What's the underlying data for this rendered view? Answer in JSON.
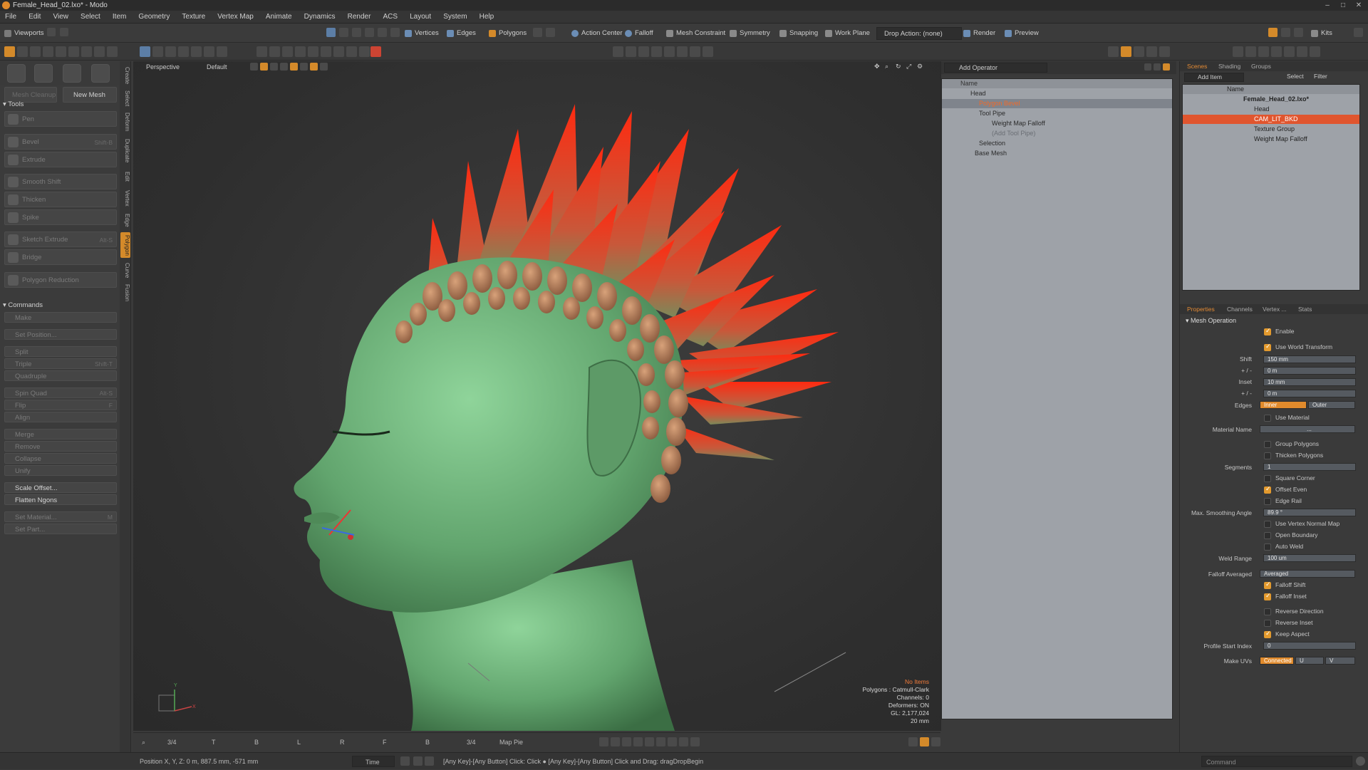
{
  "window": {
    "title": "Female_Head_02.lxo* - Modo"
  },
  "menu": [
    "File",
    "Edit",
    "View",
    "Select",
    "Item",
    "Geometry",
    "Texture",
    "Vertex Map",
    "Animate",
    "Dynamics",
    "Render",
    "ACS",
    "Layout",
    "System",
    "Help"
  ],
  "toolbar1": {
    "viewports": "Viewports",
    "vertices": "Vertices",
    "edges": "Edges",
    "polygons": "Polygons",
    "action_center": "Action Center",
    "falloff": "Falloff",
    "mesh_constraint": "Mesh Constraint",
    "symmetry": "Symmetry",
    "snapping": "Snapping",
    "work_plane": "Work Plane",
    "drop_action": "Drop Action: (none)",
    "render": "Render",
    "preview": "Preview",
    "kits": "Kits"
  },
  "left": {
    "mesh_cleanup": "Mesh Cleanup",
    "new_mesh": "New Mesh",
    "tools_header": "Tools",
    "tools": [
      {
        "label": "Pen",
        "shortcut": ""
      },
      {
        "label": "Bevel",
        "shortcut": "Shift-B"
      },
      {
        "label": "Extrude",
        "shortcut": ""
      },
      {
        "label": "Smooth Shift",
        "shortcut": ""
      },
      {
        "label": "Thicken",
        "shortcut": ""
      },
      {
        "label": "Spike",
        "shortcut": ""
      },
      {
        "label": "Sketch Extrude",
        "shortcut": "Alt-S"
      },
      {
        "label": "Bridge",
        "shortcut": ""
      },
      {
        "label": "Polygon Reduction",
        "shortcut": ""
      }
    ],
    "commands_header": "Commands",
    "commands": [
      {
        "label": "Make",
        "shortcut": ""
      },
      {
        "label": "Set Position...",
        "shortcut": ""
      },
      {
        "label": "Split",
        "shortcut": ""
      },
      {
        "label": "Triple",
        "shortcut": "Shift-T"
      },
      {
        "label": "Quadruple",
        "shortcut": ""
      },
      {
        "label": "Spin Quad",
        "shortcut": "Alt-S"
      },
      {
        "label": "Flip",
        "shortcut": "F"
      },
      {
        "label": "Align",
        "shortcut": ""
      },
      {
        "label": "Merge",
        "shortcut": ""
      },
      {
        "label": "Remove",
        "shortcut": ""
      },
      {
        "label": "Collapse",
        "shortcut": ""
      },
      {
        "label": "Unify",
        "shortcut": ""
      },
      {
        "label": "Scale Offset...",
        "shortcut": ""
      },
      {
        "label": "Flatten Ngons",
        "shortcut": ""
      },
      {
        "label": "Set Material...",
        "shortcut": "M"
      },
      {
        "label": "Set Part...",
        "shortcut": ""
      }
    ],
    "vtabs": [
      "Create",
      "Select",
      "Deform",
      "Duplicate",
      "Edit",
      "Vertex",
      "Edge",
      "Polygon",
      "Curve",
      "Fusion"
    ]
  },
  "viewport": {
    "view": "Perspective",
    "style": "Default",
    "info": {
      "items": "No Items",
      "polygons": "Polygons : Catmull-Clark",
      "channels": "Channels: 0",
      "deformers": "Deformers: ON",
      "gl": "GL: 2,177,024",
      "scale": "20 mm"
    },
    "bottom_tabs": [
      "3/4",
      "T",
      "B",
      "L",
      "R",
      "F",
      "B",
      "3/4",
      "Map Pie"
    ]
  },
  "operators": {
    "add_operator": "Add Operator",
    "name_col": "Name",
    "rows": [
      {
        "label": "Head",
        "indent": 1
      },
      {
        "label": "Polygon Bevel",
        "indent": 2,
        "selected": true
      },
      {
        "label": "Tool Pipe",
        "indent": 3
      },
      {
        "label": "Weight Map Falloff",
        "indent": 4
      },
      {
        "label": "(Add Tool Pipe)",
        "indent": 4
      },
      {
        "label": "Selection",
        "indent": 3
      },
      {
        "label": "Base Mesh",
        "indent": 2
      }
    ]
  },
  "scene": {
    "tabs": [
      "Scenes",
      "Shading",
      "Groups"
    ],
    "add_item": "Add Item",
    "select": "Select",
    "filter": "Filter",
    "name_col": "Name",
    "rows": [
      {
        "label": "Female_Head_02.lxo*",
        "indent": 0
      },
      {
        "label": "Head",
        "indent": 1
      },
      {
        "label": "CAM_LIT_BKD",
        "indent": 1,
        "highlight": true
      },
      {
        "label": "Texture Group",
        "indent": 1
      },
      {
        "label": "Weight Map Falloff",
        "indent": 1
      }
    ]
  },
  "properties": {
    "tabs": [
      "Properties",
      "Channels",
      "Vertex ...",
      "Stats"
    ],
    "section": "Mesh Operation",
    "enable": "Enable",
    "use_world_transform": "Use World Transform",
    "shift_label": "Shift",
    "shift_value": "150 mm",
    "pm1_label": "+ / -",
    "pm1_value": "0 m",
    "inset_label": "Inset",
    "inset_value": "10 mm",
    "pm2_label": "+ / -",
    "pm2_value": "0 m",
    "edges_label": "Edges",
    "edges_inner": "Inner",
    "edges_outer": "Outer",
    "use_material": "Use Material",
    "material_name": "Material Name",
    "material_value": "...",
    "group_polygons": "Group Polygons",
    "thicken_polygons": "Thicken Polygons",
    "segments_label": "Segments",
    "segments_value": "1",
    "square_corner": "Square Corner",
    "offset_even": "Offset Even",
    "edge_rail": "Edge Rail",
    "max_smoothing_label": "Max. Smoothing Angle",
    "max_smoothing_value": "89.9 °",
    "use_vertex_normal_map": "Use Vertex Normal Map",
    "open_boundary": "Open Boundary",
    "auto_weld": "Auto Weld",
    "weld_range_label": "Weld Range",
    "weld_range_value": "100 um",
    "falloff_averaged_label": "Falloff Averaged",
    "falloff_averaged_value": "Averaged",
    "falloff_shift": "Falloff Shift",
    "falloff_inset": "Falloff Inset",
    "reverse_direction": "Reverse Direction",
    "reverse_inset": "Reverse Inset",
    "keep_aspect": "Keep Aspect",
    "profile_start_label": "Profile Start Index",
    "profile_start_value": "0",
    "make_uvs_label": "Make UVs",
    "make_uvs_value": "Connected",
    "make_uvs_u": "U",
    "make_uvs_v": "V"
  },
  "status": {
    "position": "Position X, Y, Z:  0 m, 887.5 mm, -571 mm",
    "time": "Time",
    "hint": "[Any Key]-[Any Button] Click: Click ● [Any Key]-[Any Button] Click and Drag: dragDropBegin",
    "command": "Command"
  },
  "colors": {
    "accent": "#e38a34",
    "selection": "#e0552e",
    "mesh": "#6fb07a",
    "spikes": "#ff3a14"
  }
}
